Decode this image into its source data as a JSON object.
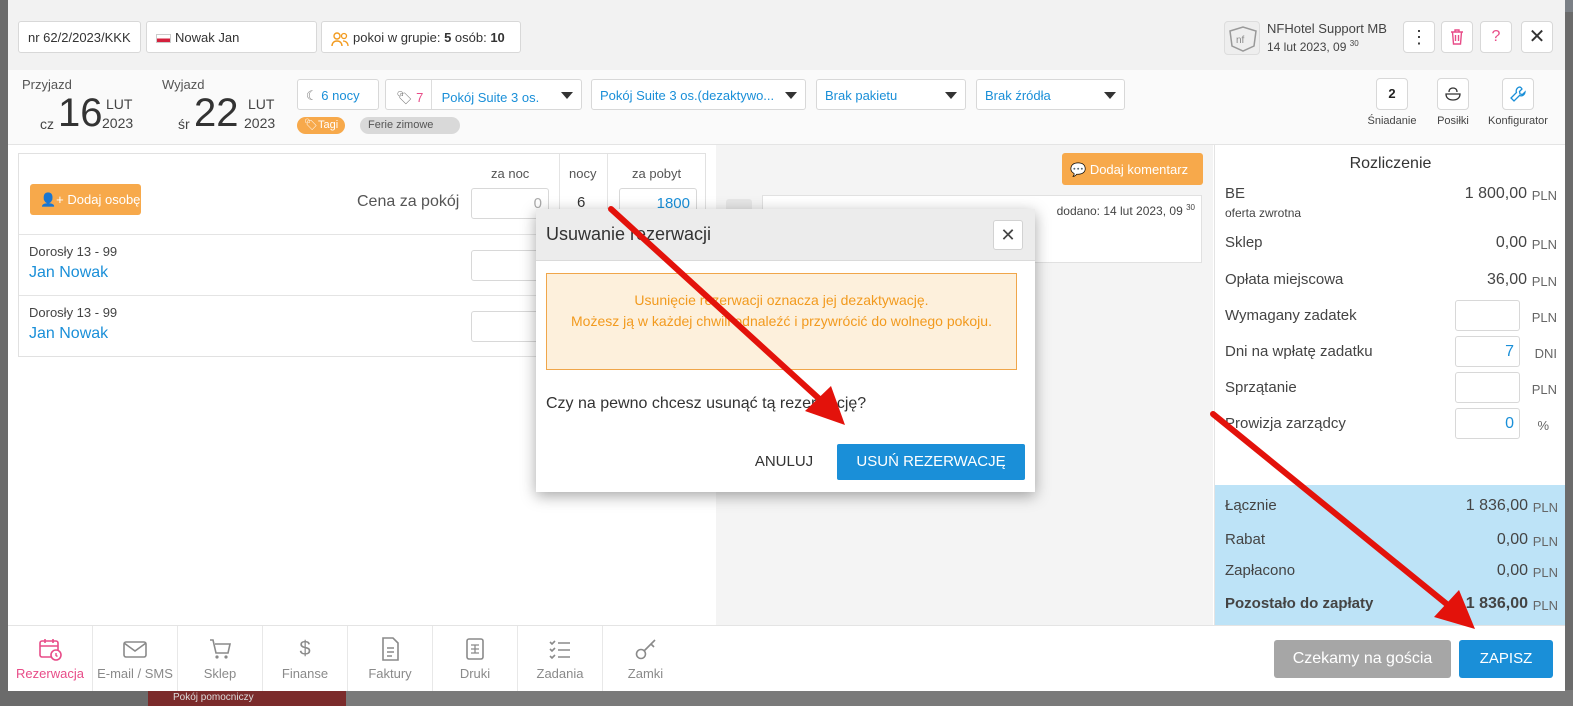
{
  "header": {
    "reservation_number": "nr 62/2/2023/KKK",
    "guest": "Nowak Jan",
    "group_prefix": "pokoi w grupie: ",
    "rooms_count": "5",
    "guests_prefix": " osób: ",
    "guests_count": "10",
    "support_name": "NFHotel Support MB",
    "support_date": "14 lut 2023, 09",
    "support_minutes": "30"
  },
  "stay": {
    "arrival_label": "Przyjazd",
    "arrival_weekday": "cz",
    "arrival_day": "16",
    "arrival_month": "LUT",
    "arrival_year": "2023",
    "departure_label": "Wyjazd",
    "departure_weekday": "śr",
    "departure_day": "22",
    "departure_month": "LUT",
    "departure_year": "2023",
    "nights": "6 nocy",
    "tag_count": "7",
    "room_type": "Pokój Suite 3 os.",
    "room": "Pokój Suite 3 os.(dezaktywo...",
    "package": "Brak pakietu",
    "source": "Brak źródła",
    "tag_label": "Tagi",
    "tag_value": "Ferie zimowe"
  },
  "meals": [
    {
      "label": "Śniadanie",
      "value": "2"
    },
    {
      "label": "Posiłki",
      "value": ""
    },
    {
      "label": "Konfigurator",
      "value": ""
    }
  ],
  "pricing": {
    "per_night_header": "za noc",
    "nights_header": "nocy",
    "per_stay_header": "za pobyt",
    "add_person": "Dodaj osobę",
    "room_price_label": "Cena za pokój",
    "per_night_value": "0",
    "nights_value": "6",
    "per_stay_value": "1800"
  },
  "guests": [
    {
      "age": "Dorosły 13 - 99",
      "name": "Jan Nowak"
    },
    {
      "age": "Dorosły 13 - 99",
      "name": "Jan Nowak"
    }
  ],
  "comments": {
    "add_button": "Dodaj komentarz",
    "added_label": "dodano: 14 lut 2023, 09",
    "added_minutes": "30"
  },
  "settlement": {
    "title": "Rozliczenie",
    "be_label": "BE",
    "be_sub": "oferta zwrotna",
    "be_value": "1 800,00",
    "shop_label": "Sklep",
    "shop_value": "0,00",
    "tax_label": "Opłata miejscowa",
    "tax_value": "36,00",
    "deposit_label": "Wymagany zadatek",
    "deposit_days_label": "Dni na wpłatę zadatku",
    "deposit_days_value": "7",
    "deposit_days_unit": "DNI",
    "cleaning_label": "Sprzątanie",
    "commission_label": "Prowizja zarządcy",
    "commission_value": "0",
    "commission_unit": "%",
    "currency": "PLN",
    "total_label": "Łącznie",
    "total_value": "1 836,00",
    "discount_label": "Rabat",
    "discount_value": "0,00",
    "paid_label": "Zapłacono",
    "paid_value": "0,00",
    "remaining_label": "Pozostało do zapłaty",
    "remaining_value": "1 836,00"
  },
  "nav": [
    {
      "label": "Rezerwacja",
      "icon": "calendar-icon"
    },
    {
      "label": "E-mail / SMS",
      "icon": "mail-icon"
    },
    {
      "label": "Sklep",
      "icon": "cart-icon"
    },
    {
      "label": "Finanse",
      "icon": "dollar-icon"
    },
    {
      "label": "Faktury",
      "icon": "invoice-icon"
    },
    {
      "label": "Druki",
      "icon": "print-icon"
    },
    {
      "label": "Zadania",
      "icon": "tasks-icon"
    },
    {
      "label": "Zamki",
      "icon": "key-icon"
    }
  ],
  "footer": {
    "waiting_button": "Czekamy na gościa",
    "save_button": "ZAPISZ"
  },
  "background": {
    "helper_room": "Pokój pomocniczy"
  },
  "dialog": {
    "title": "Usuwanie rezerwacji",
    "warning_line1": "Usunięcie rezerwacji oznacza jej dezaktywację.",
    "warning_line2": "Możesz ją w każdej chwili odnaleźć i przywrócić do wolnego pokoju.",
    "question": "Czy na pewno chcesz usunąć tą rezerwację?",
    "cancel": "ANULUJ",
    "confirm": "USUŃ REZERWACJĘ"
  },
  "colors": {
    "accent_blue": "#1a8fd8",
    "accent_orange": "#f7a94b",
    "active_pink": "#e84c88",
    "annotation_red": "#e3120b"
  }
}
